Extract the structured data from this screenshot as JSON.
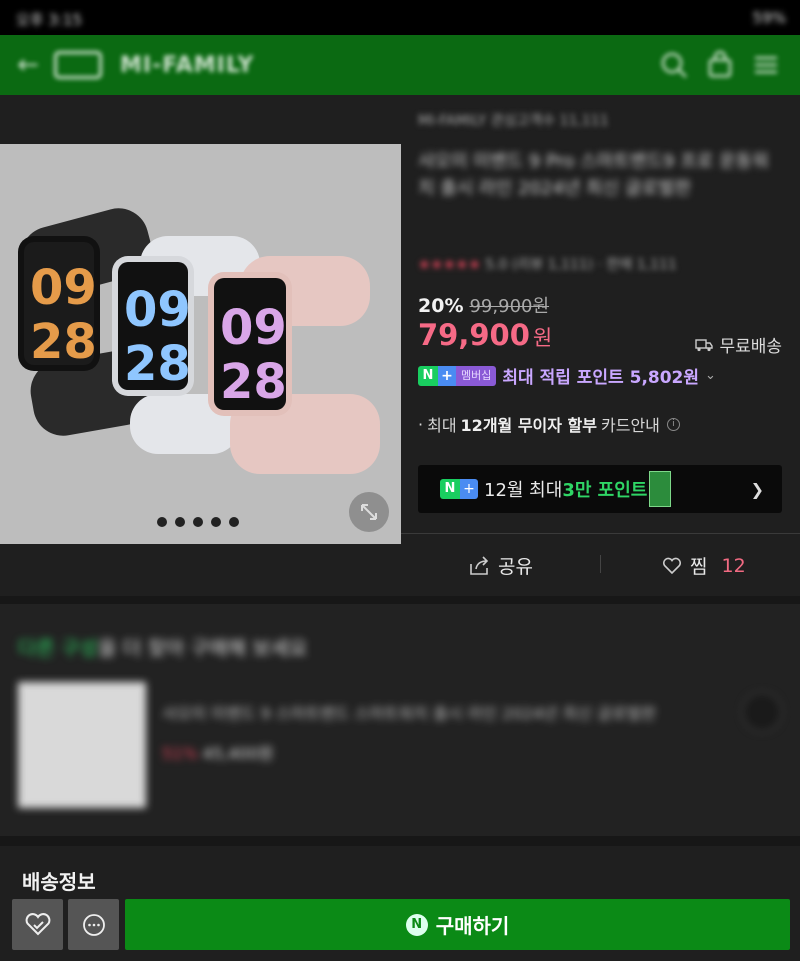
{
  "status_bar": {
    "time": "오후 3:15",
    "right": "59%"
  },
  "header": {
    "brand": "MI-FAMILY"
  },
  "seller": {
    "name": "MI-FAMILY",
    "extra": "관심고객수 11,111"
  },
  "product": {
    "title": "샤오미 미밴드 9 Pro 스마트밴드9 프로 운동워치 출시 라인 2024년 최신 글로벌판",
    "rating_text": "5.0 (리뷰 1,111) · 판매 1,111",
    "discount_pct": "20%",
    "original_price": "99,900원",
    "price": "79,900",
    "price_unit": "원",
    "free_shipping": "무료배송",
    "npay_member": "멤버십",
    "points_text": "최대 적립 포인트 5,802원",
    "installment_prefix": "최대",
    "installment_bold": "12개월 무이자 할부",
    "installment_suffix": "카드안내",
    "promo_prefix": "12월 최대",
    "promo_highlight": "3만 포인트",
    "share_label": "공유",
    "like_label": "찜",
    "like_count": "12"
  },
  "watch_faces": [
    "09",
    "28"
  ],
  "reco": {
    "heading_green": "다른 구성",
    "heading_rest": "을 더 찾아 구매해 보세요",
    "item_title": "샤오미 미밴드 9 스마트밴드 스마트워치 출시 라인 2024년 최신 글로벌판",
    "item_discount": "51%",
    "item_price": "45,400원"
  },
  "shipping_title": "배송정보",
  "buy_label": "구매하기",
  "icons": [
    "back-arrow-icon",
    "search-icon",
    "bag-icon",
    "menu-icon",
    "expand-icon",
    "truck-icon",
    "share-icon",
    "heart-icon",
    "chat-icon",
    "chevron-right-icon",
    "chevron-down-icon",
    "info-icon"
  ]
}
